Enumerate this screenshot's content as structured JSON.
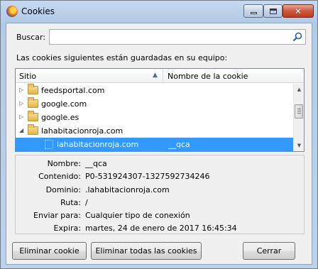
{
  "window": {
    "title": "Cookies",
    "close_glyph": "✕"
  },
  "search": {
    "label": "Buscar:",
    "value": "",
    "placeholder": ""
  },
  "intro_text": "Las cookies siguientes están guardadas en su equipo:",
  "tree": {
    "columns": {
      "site": "Sitio",
      "cookie_name": "Nombre de la cookie",
      "sort_glyph": "▲"
    },
    "rows": [
      {
        "label": "feedsportal.com",
        "expander": "▷"
      },
      {
        "label": "google.com",
        "expander": "▷"
      },
      {
        "label": "google.es",
        "expander": "▷"
      },
      {
        "label": "lahabitacionroja.com",
        "expander": "◢"
      }
    ],
    "selected": {
      "site": "lahabitacionroja.com",
      "cookie_name": "__qca"
    },
    "scroll": {
      "up_glyph": "▲",
      "down_glyph": "▼"
    }
  },
  "details": [
    {
      "label": "Nombre:",
      "value": "__qca"
    },
    {
      "label": "Contenido:",
      "value": "P0-531924307-1327592734246"
    },
    {
      "label": "Dominio:",
      "value": ".lahabitacionroja.com"
    },
    {
      "label": "Ruta:",
      "value": "/"
    },
    {
      "label": "Enviar para:",
      "value": "Cualquier tipo de conexión"
    },
    {
      "label": "Expira:",
      "value": "martes, 24 de enero de 2017 16:45:34"
    }
  ],
  "buttons": {
    "delete": "Eliminar cookie",
    "delete_all": "Eliminar todas las cookies",
    "close": "Cerrar"
  }
}
